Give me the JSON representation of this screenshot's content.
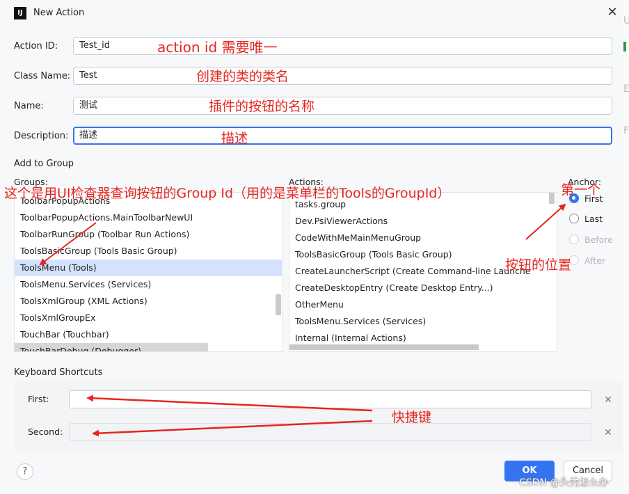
{
  "dialog": {
    "title": "New Action",
    "icon_label": "IJ",
    "close_glyph": "✕"
  },
  "fields": {
    "action_id": {
      "label": "Action ID:",
      "value": "Test_id"
    },
    "class_name": {
      "label": "Class Name:",
      "value": "Test"
    },
    "name": {
      "label": "Name:",
      "value": "测试"
    },
    "description": {
      "label": "Description:",
      "value": "描述"
    }
  },
  "add_to_group": {
    "title": "Add to Group",
    "groups_label": "Groups:",
    "actions_label": "Actions:",
    "anchor_label": "Anchor:",
    "groups": [
      "ToolbarPopupActions",
      "ToolbarPopupActions.MainToolbarNewUI",
      "ToolbarRunGroup (Toolbar Run Actions)",
      "ToolsBasicGroup (Tools Basic Group)",
      "ToolsMenu (Tools)",
      "ToolsMenu.Services (Services)",
      "ToolsXmlGroup (XML Actions)",
      "ToolsXmlGroupEx",
      "TouchBar (Touchbar)",
      "TouchBarDebug (Debugger)"
    ],
    "selected_group": "ToolsMenu (Tools)",
    "actions": [
      "tasks.group",
      "Dev.PsiViewerActions",
      "CodeWithMeMainMenuGroup",
      "ToolsBasicGroup (Tools Basic Group)",
      "CreateLauncherScript (Create Command-line Launcher...)",
      "CreateDesktopEntry (Create Desktop Entry...)",
      "OtherMenu",
      "ToolsMenu.Services (Services)",
      "Internal (Internal Actions)"
    ],
    "anchors": [
      {
        "label": "First",
        "checked": true,
        "enabled": true
      },
      {
        "label": "Last",
        "checked": false,
        "enabled": true
      },
      {
        "label": "Before",
        "checked": false,
        "enabled": false
      },
      {
        "label": "After",
        "checked": false,
        "enabled": false
      }
    ]
  },
  "keyboard_shortcuts": {
    "title": "Keyboard Shortcuts",
    "first_label": "First:",
    "second_label": "Second:",
    "clear_glyph": "✕"
  },
  "buttons": {
    "help": "?",
    "ok": "OK",
    "cancel": "Cancel"
  },
  "annotations": {
    "action_id_note": "action id 需要唯一",
    "class_name_note": "创建的类的类名",
    "name_note": "插件的按钮的名称",
    "description_note": "描述",
    "group_note": "这个是用UI检查器查询按钮的Group Id（用的是菜单栏的Tools的GroupId）",
    "first_note": "第一个",
    "position_note": "按钮的位置",
    "shortcut_note": "快捷键",
    "color": "#e5261f"
  },
  "watermark": "CSDN @头秃怎么办",
  "edge_chars": [
    "U",
    "n",
    "E",
    "F"
  ]
}
